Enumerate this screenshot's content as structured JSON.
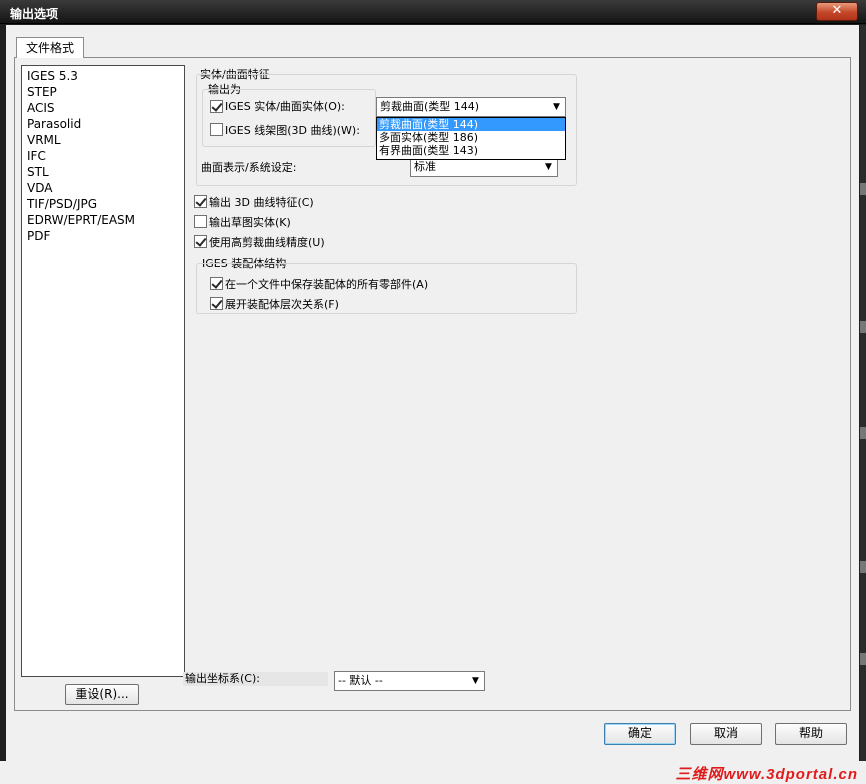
{
  "window": {
    "title": "输出选项",
    "close_glyph": "✕"
  },
  "tabs": [
    {
      "label": "文件格式"
    }
  ],
  "formats": [
    "IGES 5.3",
    "STEP",
    "ACIS",
    "Parasolid",
    "VRML",
    "IFC",
    "STL",
    "VDA",
    "TIF/PSD/JPG",
    "EDRW/EPRT/EASM",
    "PDF"
  ],
  "reset_button": "重设(R)...",
  "solid_surface": {
    "group_title": "实体/曲面特征",
    "output_as_title": "输出为",
    "iges_solid_label": "IGES 实体/曲面实体(O):",
    "iges_solid_checked": true,
    "iges_solid_value": "剪裁曲面(类型 144)",
    "iges_wire_label": "IGES 线架图(3D 曲线)(W):",
    "iges_wire_checked": false,
    "dropdown_options": [
      "剪裁曲面(类型 144)",
      "多面实体(类型 186)",
      "有界曲面(类型 143)"
    ],
    "dropdown_selected_index": 0,
    "surface_repr_label": "曲面表示/系统设定:",
    "surface_repr_value": "标准"
  },
  "options": [
    {
      "label": "输出 3D 曲线特征(C)",
      "checked": true
    },
    {
      "label": "输出草图实体(K)",
      "checked": false
    },
    {
      "label": "使用高剪裁曲线精度(U)",
      "checked": true
    }
  ],
  "assembly": {
    "group_title": "IGES 装配体结构",
    "items": [
      {
        "label": "在一个文件中保存装配体的所有零部件(A)",
        "checked": true
      },
      {
        "label": "展开装配体层次关系(F)",
        "checked": true
      }
    ]
  },
  "coordinate": {
    "label": "输出坐标系(C):",
    "value": "-- 默认 --"
  },
  "buttons": {
    "ok": "确定",
    "cancel": "取消",
    "help": "帮助"
  },
  "watermark": "三维网www.3dportal.cn",
  "icons": {
    "dropdown_arrow": "▼"
  }
}
